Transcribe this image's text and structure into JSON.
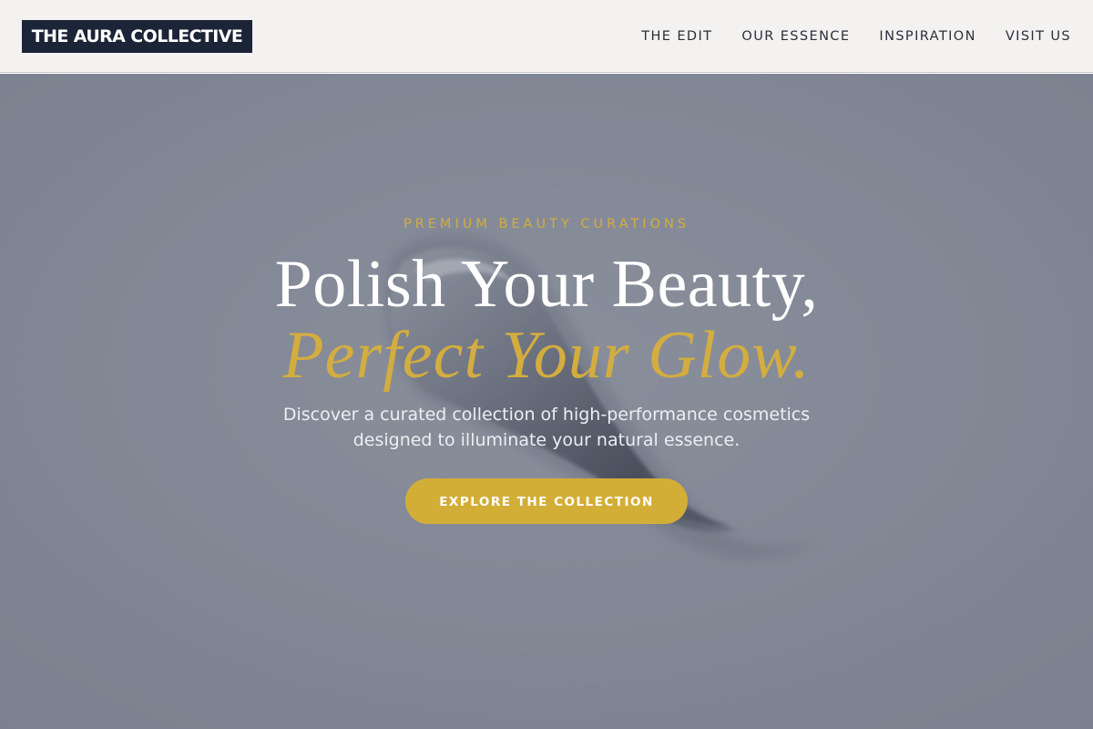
{
  "header": {
    "brand": "THE AURA COLLECTIVE",
    "nav": [
      {
        "label": "THE EDIT"
      },
      {
        "label": "OUR ESSENCE"
      },
      {
        "label": "INSPIRATION"
      },
      {
        "label": "VISIT US"
      }
    ]
  },
  "hero": {
    "eyebrow": "PREMIUM BEAUTY CURATIONS",
    "headline_line1": "Polish Your Beauty,",
    "headline_line2": "Perfect Your Glow.",
    "subtitle_line1": "Discover a curated collection of high-performance cosmetics",
    "subtitle_line2": "designed to illuminate your natural essence.",
    "cta_label": "EXPLORE THE COLLECTION"
  },
  "colors": {
    "brand_bg": "#1c2537",
    "accent_gold": "#d3ad3f",
    "nav_bg": "#f3f2f0",
    "hero_bg": "#858a96",
    "nav_text": "#2b2f3a"
  }
}
